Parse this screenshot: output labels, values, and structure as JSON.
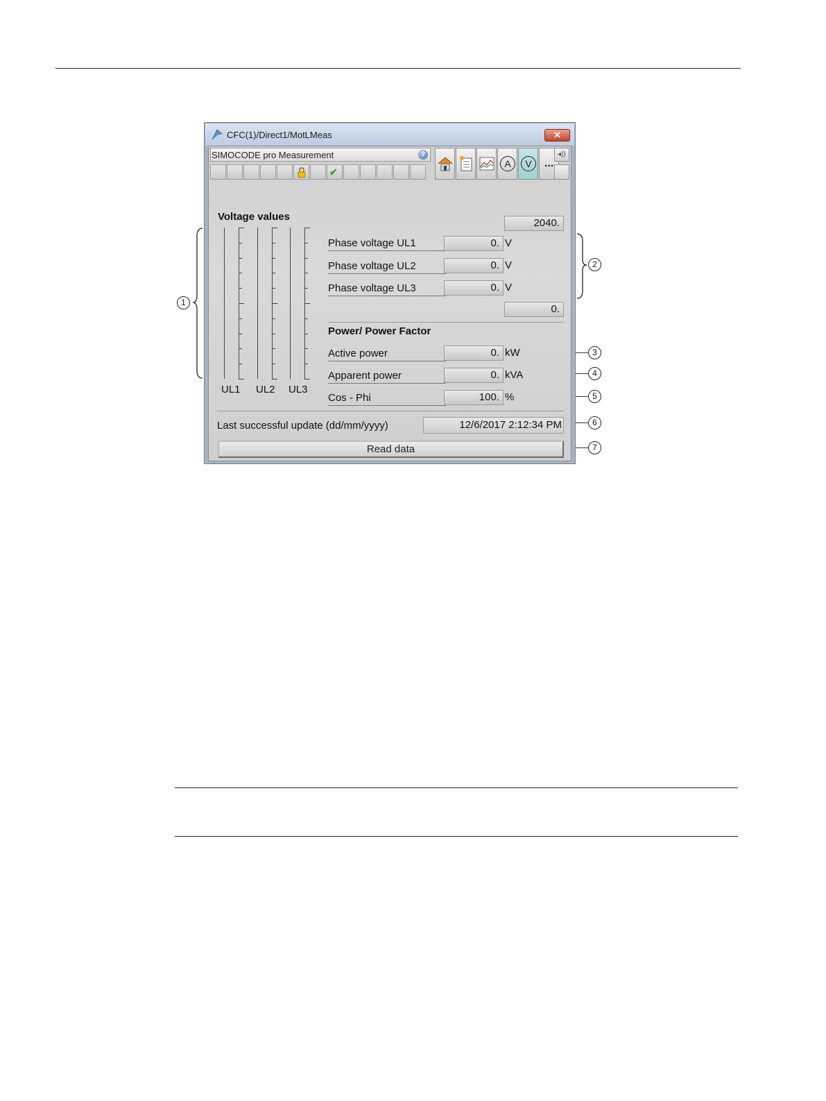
{
  "window": {
    "title": "CFC(1)/Direct1/MotLMeas",
    "close_icon": "close-icon",
    "app_icon": "app-icon"
  },
  "faceplate": {
    "title": "SIMOCODE pro Measurement",
    "help_icon": "?",
    "nav_buttons": [
      {
        "name": "home-view-icon"
      },
      {
        "name": "notes-view-icon"
      },
      {
        "name": "trend-view-icon"
      },
      {
        "name": "current-view-icon",
        "label": "A"
      },
      {
        "name": "voltage-view-icon",
        "label": "V",
        "active": true
      },
      {
        "name": "more-views-icon",
        "label": "..."
      }
    ],
    "speaker_icon": "◂))"
  },
  "voltage": {
    "title": "Voltage values",
    "bars": [
      {
        "label": "UL1",
        "value": 0
      },
      {
        "label": "UL2",
        "value": 0
      },
      {
        "label": "UL3",
        "value": 0
      }
    ],
    "upper_limit": "2040.",
    "lower_limit": "0.",
    "rows": [
      {
        "label": "Phase voltage UL1",
        "value": "0.",
        "unit": "V"
      },
      {
        "label": "Phase voltage UL2",
        "value": "0.",
        "unit": "V"
      },
      {
        "label": "Phase voltage UL3",
        "value": "0.",
        "unit": "V"
      }
    ]
  },
  "power": {
    "title": "Power/ Power Factor",
    "rows": [
      {
        "label": "Active power",
        "value": "0.",
        "unit": "kW"
      },
      {
        "label": "Apparent power",
        "value": "0.",
        "unit": "kVA"
      },
      {
        "label": "Cos - Phi",
        "value": "100.",
        "unit": "%"
      }
    ]
  },
  "update": {
    "label": "Last successful update (dd/mm/yyyy)",
    "value": "12/6/2017  2:12:34 PM"
  },
  "read_button": "Read data",
  "callouts": [
    "1",
    "2",
    "3",
    "4",
    "5",
    "6",
    "7"
  ]
}
